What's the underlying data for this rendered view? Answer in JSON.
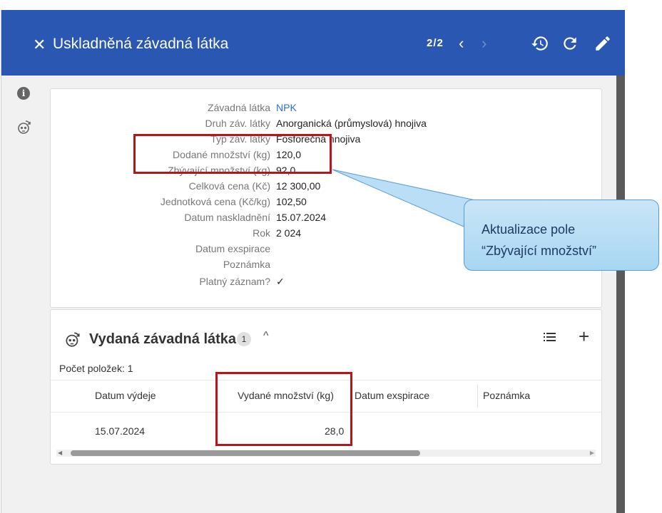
{
  "header": {
    "close_icon": "close-icon",
    "title": "Uskladněná závadná látka",
    "pager": "2/2",
    "prev": "‹",
    "next": "›",
    "icons": [
      "history-icon",
      "refresh-icon",
      "edit-icon"
    ]
  },
  "sidebar": {
    "icons": [
      "info-icon",
      "skull-icon"
    ]
  },
  "details": {
    "rows": [
      {
        "label": "Závadná látka",
        "value": "NPK"
      },
      {
        "label": "Druh záv. látky",
        "value": "Anorganická (průmyslová) hnojiva"
      },
      {
        "label": "Typ záv. látky",
        "value": "Fosforečná hnojiva"
      },
      {
        "label": "Dodané množství (kg)",
        "value": "120,0"
      },
      {
        "label": "Zbývající množství (kg)",
        "value": "92,0"
      },
      {
        "label": "Celková cena (Kč)",
        "value": "12 300,00"
      },
      {
        "label": "Jednotková cena (Kč/kg)",
        "value": "102,50"
      },
      {
        "label": "Datum naskladnění",
        "value": "15.07.2024"
      },
      {
        "label": "Rok",
        "value": "2 024"
      },
      {
        "label": "Datum exspirace",
        "value": ""
      },
      {
        "label": "Poznámka",
        "value": ""
      },
      {
        "label": "Platný záznam?",
        "value": "✓"
      }
    ]
  },
  "section": {
    "title": "Vydaná závadná látka",
    "badge": "1",
    "chevron": "^",
    "add": "+",
    "count_label": "Počet položek: 1",
    "columns": [
      "Datum výdeje",
      "Vydané množství (kg)",
      "Datum exspirace",
      "Poznámka"
    ],
    "rows": [
      {
        "date": "15.07.2024",
        "amount": "28,0",
        "expiry": "",
        "note": ""
      }
    ]
  },
  "callout": {
    "line1": "Aktualizace pole",
    "line2": "“Zbývající množství”"
  },
  "colors": {
    "header_bg": "#2957b1",
    "highlight": "#b8141b",
    "link": "#2a6fd6",
    "callout_border": "#5b9bd5"
  }
}
